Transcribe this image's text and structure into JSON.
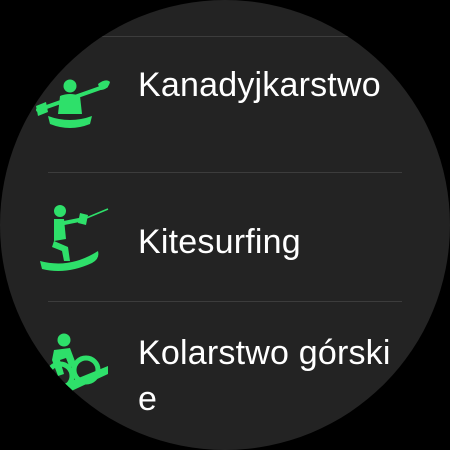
{
  "screen": {
    "background": "#232323",
    "accent": "#2ee06a"
  },
  "list": {
    "top_partial_label": "",
    "items": [
      {
        "label": "Kanadyjkarstwo",
        "icon": "kayak-icon"
      },
      {
        "label": "Kitesurfing",
        "icon": "kitesurf-icon"
      },
      {
        "label": "Kolarstwo górskie",
        "icon": "mountain-bike-icon"
      }
    ]
  }
}
